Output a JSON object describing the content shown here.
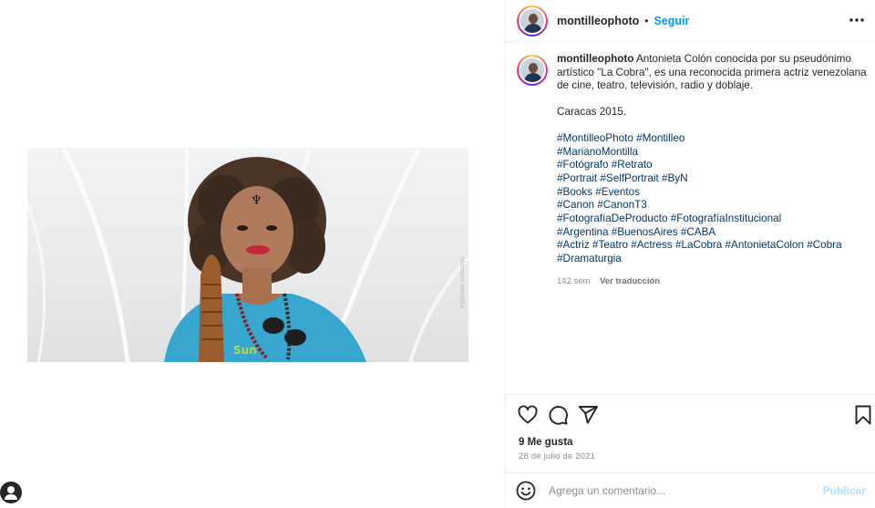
{
  "post": {
    "username": "montilleophoto",
    "follow_label": "Seguir",
    "separator": "•",
    "caption": "Antonieta Colón conocida por su pseudónimo artístico \"La Cobra\", es una reconocida primera actriz venezolana de cine, teatro, televisión, radio y doblaje.",
    "location": "Caracas 2015.",
    "hashtag_lines": [
      [
        "#MontilleoPhoto",
        "#Montilleo"
      ],
      [
        "#MarianoMontilla"
      ],
      [
        "#Fotógrafo",
        "#Retrato"
      ],
      [
        "#Portrait",
        "#SelfPortrait",
        "#ByN"
      ],
      [
        "#Books",
        "#Eventos"
      ],
      [
        "#Canon",
        "#CanonT3"
      ],
      [
        "#FotografíaDeProducto",
        "#FotografíaInstitucional"
      ],
      [
        "#Argentina",
        "#BuenosAires",
        "#CABA"
      ],
      [
        "#Actriz",
        "#Teatro",
        "#Actress",
        "#LaCobra",
        "#AntonietaColon",
        "#Cobra"
      ],
      [
        "#Dramaturgia"
      ]
    ],
    "age": "142 sem",
    "translate_label": "Ver traducción",
    "likes": "9 Me gusta",
    "date": "28 de julio de 2021",
    "watermark": "Mariano Montilla"
  },
  "comment": {
    "placeholder": "Agrega un comentario...",
    "publish_label": "Publicar"
  },
  "icons": {
    "heart": "heart-icon",
    "comment": "comment-icon",
    "share": "share-icon",
    "save": "bookmark-icon",
    "more": "more-options-icon",
    "emoji": "emoji-icon"
  },
  "colors": {
    "link": "#0095f6",
    "hashtag": "#00376b",
    "muted": "#8e8e8e",
    "publish_disabled": "#b2dffc"
  }
}
